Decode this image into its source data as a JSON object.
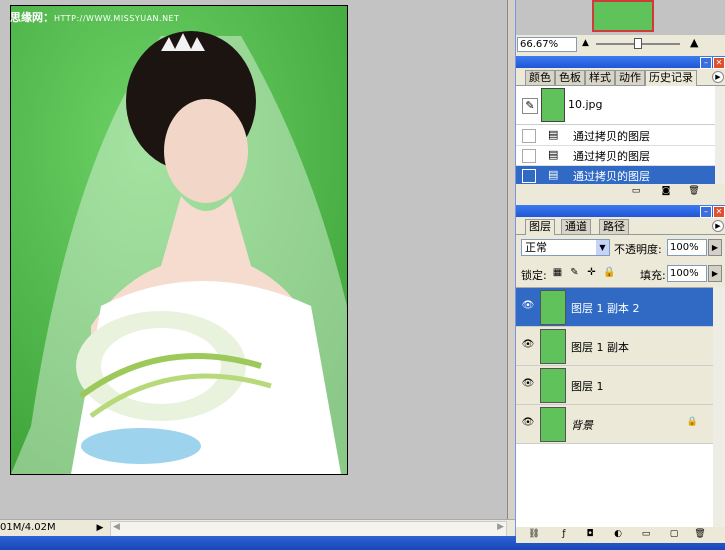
{
  "document": {
    "watermark_cn": "思缘网：",
    "watermark_url": "HTTP://WWW.MISSYUAN.NET",
    "status_size": "01M/4.02M",
    "status_arrow": "▶"
  },
  "navigator": {
    "zoom": "66.67%"
  },
  "history_panel": {
    "tabs": [
      "颜色",
      "色板",
      "样式",
      "动作",
      "历史记录"
    ],
    "active_tab": "历史记录",
    "snapshot_label": "10.jpg",
    "items": [
      {
        "label": "通过拷贝的图层"
      },
      {
        "label": "通过拷贝的图层"
      },
      {
        "label": "通过拷贝的图层"
      }
    ]
  },
  "layers_panel": {
    "tabs": [
      "图层",
      "通道",
      "路径"
    ],
    "active_tab": "图层",
    "blend_mode": "正常",
    "opacity_label": "不透明度:",
    "opacity": "100%",
    "lock_label": "锁定:",
    "fill_label": "填充:",
    "fill": "100%",
    "layers": [
      {
        "name": "图层 1 副本 2",
        "selected": true
      },
      {
        "name": "图层 1 副本",
        "selected": false
      },
      {
        "name": "图层 1",
        "selected": false
      },
      {
        "name": "背景",
        "selected": false,
        "locked": true
      }
    ]
  },
  "colors": {
    "selection": "#316ac5",
    "titlebar": "#1f56d6",
    "panel_bg": "#ece9d8",
    "canvas_green": "#5fc25a"
  }
}
